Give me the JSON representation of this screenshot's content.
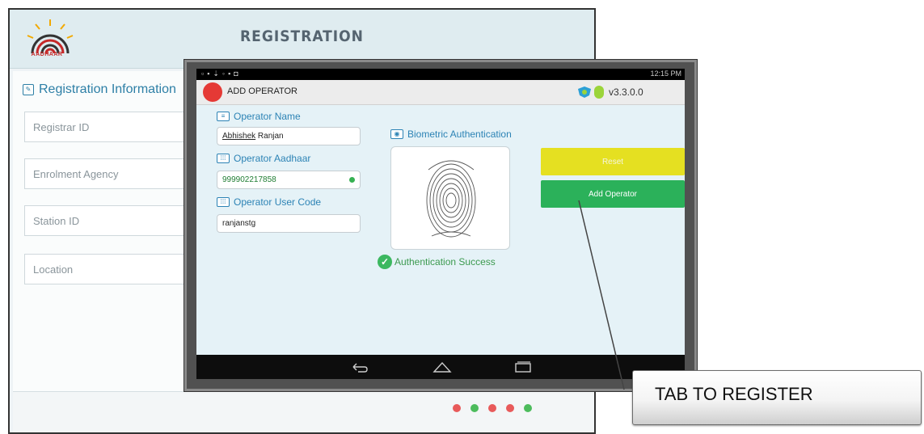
{
  "background_screen": {
    "logo_text": "AADHAAR",
    "title": "REGISTRATION",
    "section_title": "Registration Information",
    "fields": [
      {
        "label": "Registrar ID",
        "status": "ok"
      },
      {
        "label": "Enrolment Agency",
        "status": "error"
      },
      {
        "label": "Station ID",
        "status": "ok"
      },
      {
        "label": "Location",
        "status": "ok"
      }
    ]
  },
  "status_bar": {
    "time": "12:15 PM"
  },
  "app_bar": {
    "title": "ADD OPERATOR",
    "version": "v3.3.0.0"
  },
  "form": {
    "operator_name_label": "Operator Name",
    "operator_name_first": "Abhishek",
    "operator_name_last": " Ranjan",
    "operator_aadhaar_label": "Operator Aadhaar",
    "operator_aadhaar_value": "999902217858",
    "operator_user_code_label": "Operator User Code",
    "operator_user_code_value": "ranjanstg",
    "biometric_label": "Biometric Authentication",
    "auth_status": "Authentication Success"
  },
  "buttons": {
    "reset": "Reset",
    "add_operator": "Add Operator"
  },
  "callout": {
    "text": "TAB TO REGISTER"
  },
  "colors": {
    "accent_blue": "#2c83b5",
    "reset_yellow": "#e5e021",
    "add_green": "#2bb15a",
    "success_green": "#3cb860"
  }
}
